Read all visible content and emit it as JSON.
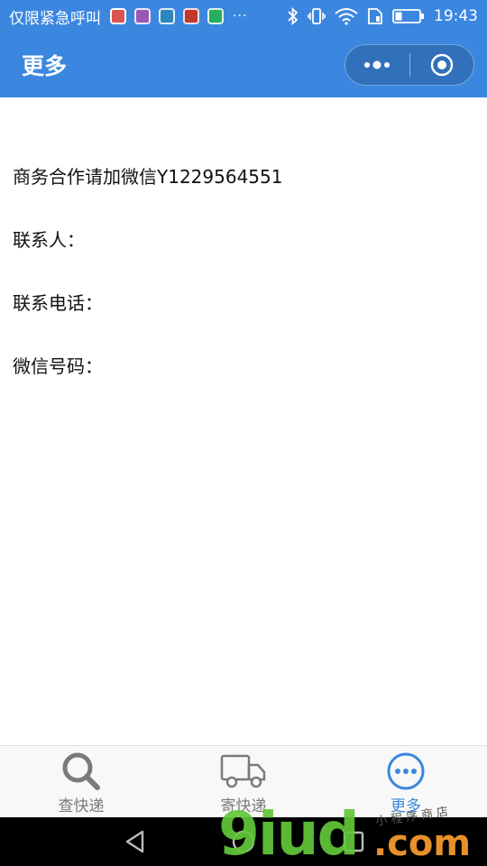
{
  "status_bar": {
    "carrier": "仅限紧急呼叫",
    "overflow": "···",
    "time": "19:43",
    "icons": [
      "notification-icon-1",
      "notification-icon-2",
      "notification-icon-3",
      "notification-icon-4",
      "notification-icon-5",
      "bluetooth-icon",
      "vibrate-icon",
      "wifi-icon",
      "sim-icon",
      "battery-icon"
    ]
  },
  "navbar": {
    "title": "更多"
  },
  "content": {
    "lines": [
      "商务合作请加微信Y1229564551",
      "联系人：",
      "联系电话：",
      "微信号码："
    ]
  },
  "tabbar": {
    "tabs": [
      {
        "label": "查快递",
        "icon": "search-icon"
      },
      {
        "label": "寄快递",
        "icon": "truck-icon"
      },
      {
        "label": "更多",
        "icon": "more-icon"
      }
    ],
    "active_index": 2
  },
  "watermark": {
    "digits": "9iud",
    "domain": ".com",
    "small": "小程序商店"
  },
  "colors": {
    "accent": "#3b87e0",
    "inactive": "#7a7a7a"
  }
}
